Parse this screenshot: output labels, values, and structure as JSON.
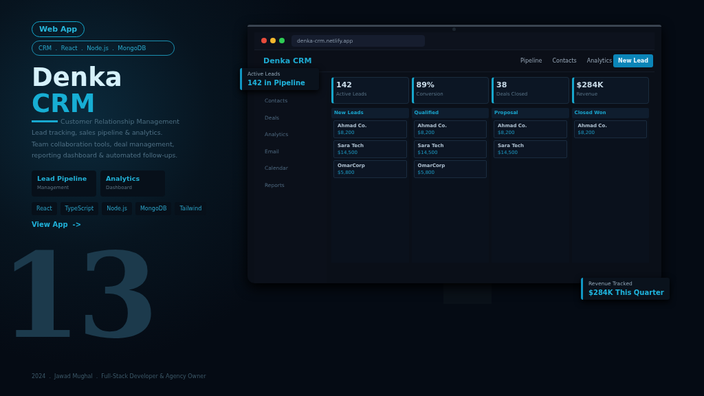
{
  "badge": "Web App",
  "stack_line": "CRM  .  React  .  Node.js  .  MongoDB",
  "title": {
    "line1": "Denka",
    "line2": "CRM"
  },
  "subtitle": "Customer Relationship Management",
  "description": [
    "Lead tracking, sales pipeline & analytics.",
    "Team collaboration tools, deal management,",
    "reporting dashboard & automated follow-ups."
  ],
  "features": [
    {
      "title": "Lead Pipeline",
      "caption": "Management"
    },
    {
      "title": "Analytics",
      "caption": "Dashboard"
    }
  ],
  "tech_tags": [
    "React",
    "TypeScript",
    "Node.js",
    "MongoDB",
    "Tailwind"
  ],
  "cta": "View App  ->",
  "big_number": "13",
  "footer": "2024  .  Jawad Mughal  .  Full-Stack Developer & Agency Owner",
  "browser": {
    "url": "denka-crm.netlify.app"
  },
  "app": {
    "brand": "Denka CRM",
    "nav": [
      "Pipeline",
      "Contacts",
      "Analytics"
    ],
    "primary_button": "New Lead",
    "sidebar": [
      "Contacts",
      "Deals",
      "Analytics",
      "Email",
      "Calendar",
      "Reports"
    ],
    "stats": [
      {
        "value": "142",
        "label": "Active Leads"
      },
      {
        "value": "89%",
        "label": "Conversion"
      },
      {
        "value": "38",
        "label": "Deals Closed"
      },
      {
        "value": "$284K",
        "label": "Revenue"
      }
    ],
    "columns": [
      {
        "title": "New Leads",
        "cards": [
          {
            "name": "Ahmad Co.",
            "amount": "$8,200"
          },
          {
            "name": "Sara Tech",
            "amount": "$14,500"
          },
          {
            "name": "OmarCorp",
            "amount": "$5,800"
          }
        ]
      },
      {
        "title": "Qualified",
        "cards": [
          {
            "name": "Ahmad Co.",
            "amount": "$8,200"
          },
          {
            "name": "Sara Tech",
            "amount": "$14,500"
          },
          {
            "name": "OmarCorp",
            "amount": "$5,800"
          }
        ]
      },
      {
        "title": "Proposal",
        "cards": [
          {
            "name": "Ahmad Co.",
            "amount": "$8,200"
          },
          {
            "name": "Sara Tech",
            "amount": "$14,500"
          }
        ]
      },
      {
        "title": "Closed Won",
        "cards": [
          {
            "name": "Ahmad Co.",
            "amount": "$8,200"
          }
        ]
      }
    ]
  },
  "callouts": [
    {
      "label": "Active Leads",
      "value": "142 in Pipeline"
    },
    {
      "label": "Revenue Tracked",
      "value": "$284K This Quarter"
    }
  ]
}
